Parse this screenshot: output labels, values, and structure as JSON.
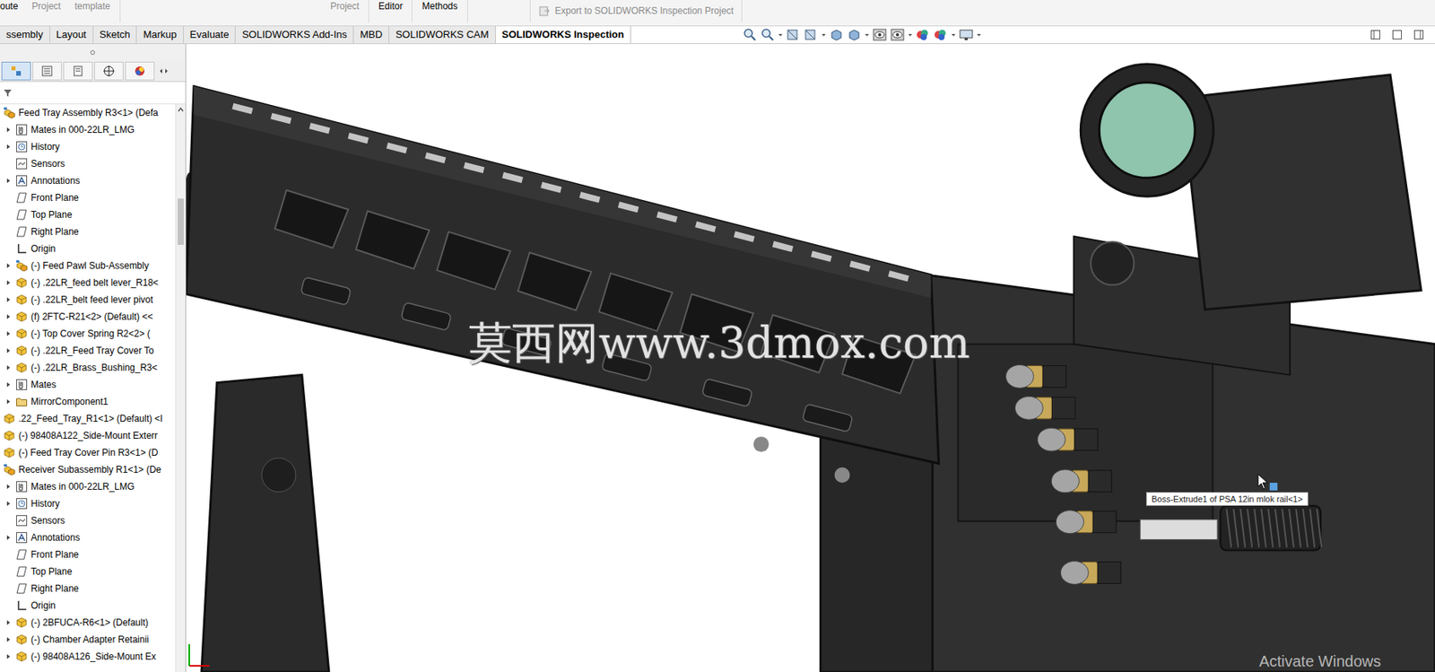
{
  "ribbon": {
    "groups": [
      {
        "items": [
          {
            "label": "oute",
            "disabled": false
          },
          {
            "label": "Project",
            "disabled": true
          },
          {
            "label": "template",
            "disabled": true
          }
        ]
      },
      {
        "items": [
          {
            "label": "Project",
            "disabled": true
          }
        ]
      },
      {
        "items": [
          {
            "label": "Editor",
            "disabled": false
          }
        ]
      },
      {
        "items": [
          {
            "label": "Methods",
            "disabled": false
          }
        ]
      }
    ],
    "export_button": {
      "label": "Export to SOLIDWORKS Inspection Project",
      "disabled": true
    }
  },
  "tabs": [
    {
      "label": "ssembly",
      "selected": false
    },
    {
      "label": "Layout",
      "selected": false
    },
    {
      "label": "Sketch",
      "selected": false
    },
    {
      "label": "Markup",
      "selected": false
    },
    {
      "label": "Evaluate",
      "selected": false
    },
    {
      "label": "SOLIDWORKS Add-Ins",
      "selected": false
    },
    {
      "label": "MBD",
      "selected": false
    },
    {
      "label": "SOLIDWORKS CAM",
      "selected": false
    },
    {
      "label": "SOLIDWORKS Inspection",
      "selected": true
    }
  ],
  "feature_tree": {
    "items": [
      {
        "label": "Feed Tray Assembly R3<1> (Defa",
        "level": 0,
        "expandable": false,
        "kind": "assembly"
      },
      {
        "label": "Mates in 000-22LR_LMG",
        "level": 1,
        "expandable": true,
        "kind": "mates"
      },
      {
        "label": "History",
        "level": 1,
        "expandable": true,
        "kind": "history"
      },
      {
        "label": "Sensors",
        "level": 1,
        "expandable": false,
        "kind": "sensors"
      },
      {
        "label": "Annotations",
        "level": 1,
        "expandable": true,
        "kind": "annotations"
      },
      {
        "label": "Front Plane",
        "level": 1,
        "expandable": false,
        "kind": "plane"
      },
      {
        "label": "Top Plane",
        "level": 1,
        "expandable": false,
        "kind": "plane"
      },
      {
        "label": "Right Plane",
        "level": 1,
        "expandable": false,
        "kind": "plane"
      },
      {
        "label": "Origin",
        "level": 1,
        "expandable": false,
        "kind": "origin"
      },
      {
        "label": "(-) Feed Pawl Sub-Assembly",
        "level": 1,
        "expandable": true,
        "kind": "assembly"
      },
      {
        "label": "(-) .22LR_feed belt lever_R18<",
        "level": 1,
        "expandable": true,
        "kind": "part"
      },
      {
        "label": "(-) .22LR_belt feed lever pivot",
        "level": 1,
        "expandable": true,
        "kind": "part"
      },
      {
        "label": "(f) 2FTC-R21<2> (Default) <<",
        "level": 1,
        "expandable": true,
        "kind": "part"
      },
      {
        "label": "(-) Top Cover Spring R2<2> (",
        "level": 1,
        "expandable": true,
        "kind": "part"
      },
      {
        "label": "(-) .22LR_Feed Tray Cover To",
        "level": 1,
        "expandable": true,
        "kind": "part"
      },
      {
        "label": "(-) .22LR_Brass_Bushing_R3<",
        "level": 1,
        "expandable": true,
        "kind": "part"
      },
      {
        "label": "Mates",
        "level": 1,
        "expandable": true,
        "kind": "mates"
      },
      {
        "label": "MirrorComponent1",
        "level": 1,
        "expandable": true,
        "kind": "folder"
      },
      {
        "label": ".22_Feed_Tray_R1<1> (Default) <I",
        "level": 0,
        "expandable": false,
        "kind": "part"
      },
      {
        "label": "(-) 98408A122_Side-Mount Exterr",
        "level": 0,
        "expandable": false,
        "kind": "part"
      },
      {
        "label": "(-) Feed Tray Cover Pin R3<1> (D",
        "level": 0,
        "expandable": false,
        "kind": "part"
      },
      {
        "label": "Receiver Subassembly R1<1> (De",
        "level": 0,
        "expandable": false,
        "kind": "assembly"
      },
      {
        "label": "Mates in 000-22LR_LMG",
        "level": 1,
        "expandable": true,
        "kind": "mates"
      },
      {
        "label": "History",
        "level": 1,
        "expandable": true,
        "kind": "history"
      },
      {
        "label": "Sensors",
        "level": 1,
        "expandable": false,
        "kind": "sensors"
      },
      {
        "label": "Annotations",
        "level": 1,
        "expandable": true,
        "kind": "annotations"
      },
      {
        "label": "Front Plane",
        "level": 1,
        "expandable": false,
        "kind": "plane"
      },
      {
        "label": "Top Plane",
        "level": 1,
        "expandable": false,
        "kind": "plane"
      },
      {
        "label": "Right Plane",
        "level": 1,
        "expandable": false,
        "kind": "plane"
      },
      {
        "label": "Origin",
        "level": 1,
        "expandable": false,
        "kind": "origin"
      },
      {
        "label": "(-) 2BFUCA-R6<1> (Default)",
        "level": 1,
        "expandable": true,
        "kind": "part"
      },
      {
        "label": "(-) Chamber Adapter Retainii",
        "level": 1,
        "expandable": true,
        "kind": "part"
      },
      {
        "label": "(-) 98408A126_Side-Mount Ex",
        "level": 1,
        "expandable": true,
        "kind": "part"
      }
    ]
  },
  "viewport": {
    "tooltip": "Boss-Extrude1 of PSA 12in mlok rail<1>",
    "watermark": "莫西网www.3dmox.com",
    "activation_notice": "Activate Windows"
  }
}
